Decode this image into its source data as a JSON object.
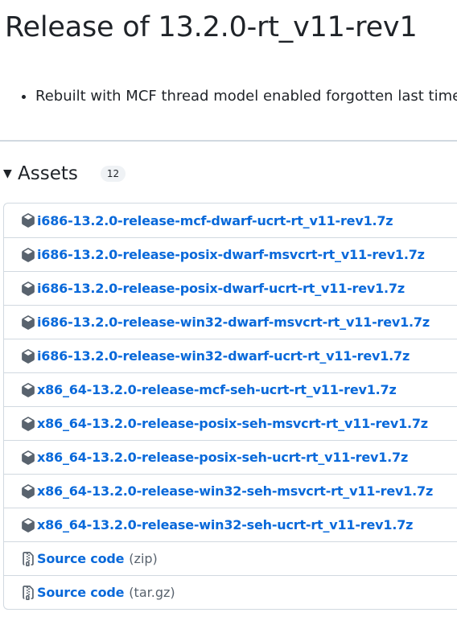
{
  "release": {
    "title": "Release of 13.2.0-rt_v11-rev1",
    "notes": [
      "Rebuilt with MCF thread model enabled forgotten last time"
    ]
  },
  "assets": {
    "title": "Assets",
    "count": "12",
    "files": [
      "i686-13.2.0-release-mcf-dwarf-ucrt-rt_v11-rev1.7z",
      "i686-13.2.0-release-posix-dwarf-msvcrt-rt_v11-rev1.7z",
      "i686-13.2.0-release-posix-dwarf-ucrt-rt_v11-rev1.7z",
      "i686-13.2.0-release-win32-dwarf-msvcrt-rt_v11-rev1.7z",
      "i686-13.2.0-release-win32-dwarf-ucrt-rt_v11-rev1.7z",
      "x86_64-13.2.0-release-mcf-seh-ucrt-rt_v11-rev1.7z",
      "x86_64-13.2.0-release-posix-seh-msvcrt-rt_v11-rev1.7z",
      "x86_64-13.2.0-release-posix-seh-ucrt-rt_v11-rev1.7z",
      "x86_64-13.2.0-release-win32-seh-msvcrt-rt_v11-rev1.7z",
      "x86_64-13.2.0-release-win32-seh-ucrt-rt_v11-rev1.7z"
    ],
    "source": [
      {
        "label": "Source code",
        "format": "(zip)"
      },
      {
        "label": "Source code",
        "format": "(tar.gz)"
      }
    ],
    "icons": {
      "file": "package-icon",
      "source": "file-zip-icon"
    },
    "colors": {
      "link": "#0969da",
      "muted": "#59636e",
      "border": "#d1d9e0"
    }
  }
}
